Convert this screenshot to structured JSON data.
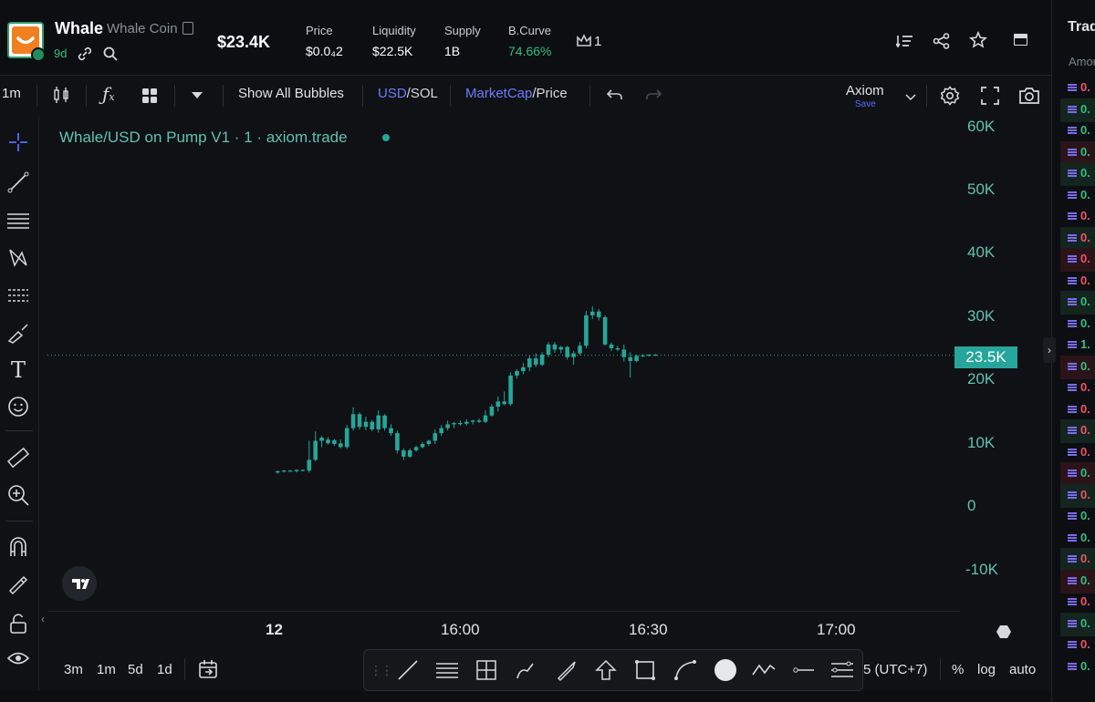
{
  "token": {
    "symbol": "Whale",
    "name": "Whale Coin",
    "age": "9d",
    "market_cap": "$23.4K"
  },
  "stats": [
    {
      "label": "Price",
      "value": "$0.0₄2"
    },
    {
      "label": "Liquidity",
      "value": "$22.5K"
    },
    {
      "label": "Supply",
      "value": "1B"
    },
    {
      "label": "B.Curve",
      "value": "74.66%"
    }
  ],
  "holders_count": "1",
  "toolbar": {
    "interval": "1m",
    "show_bubbles": "Show All Bubbles",
    "currency_primary": "USD",
    "currency_secondary": "/SOL",
    "metric_primary": "MarketCap",
    "metric_secondary": "/Price",
    "layout_name": "Axiom",
    "layout_save": "Save"
  },
  "chart_title": "Whale/USD on Pump V1 · 1 · axiom.trade",
  "price_tag": "23.5K",
  "y_axis_labels": [
    "60K",
    "50K",
    "40K",
    "30K",
    "20K",
    "10K",
    "0",
    "-10K"
  ],
  "x_axis_labels": [
    "12",
    "16:00",
    "16:30",
    "17:00"
  ],
  "bottom": {
    "ranges": [
      "3m",
      "1m",
      "5d",
      "1d"
    ],
    "timezone": "5 (UTC+7)",
    "percent": "%",
    "log": "log",
    "auto": "auto"
  },
  "sidebar": {
    "header": "Trad",
    "sub_header": "Amou",
    "rows": [
      {
        "value": "0.",
        "color": "#f05261"
      },
      {
        "value": "0.",
        "color": "#2fbf7f"
      },
      {
        "value": "0.",
        "color": "#2fbf7f"
      },
      {
        "value": "0.",
        "color": "#2fbf7f"
      },
      {
        "value": "0.",
        "color": "#2fbf7f"
      },
      {
        "value": "0.",
        "color": "#2fbf7f"
      },
      {
        "value": "0.",
        "color": "#f05261"
      },
      {
        "value": "0.",
        "color": "#f05261"
      },
      {
        "value": "0.",
        "color": "#f05261"
      },
      {
        "value": "0.",
        "color": "#f05261"
      },
      {
        "value": "0.",
        "color": "#2fbf7f"
      },
      {
        "value": "0.",
        "color": "#2fbf7f"
      },
      {
        "value": "1.",
        "color": "#2fbf7f"
      },
      {
        "value": "0.",
        "color": "#2fbf7f"
      },
      {
        "value": "0.",
        "color": "#f05261"
      },
      {
        "value": "0.",
        "color": "#f05261"
      },
      {
        "value": "0.",
        "color": "#f05261"
      },
      {
        "value": "0.",
        "color": "#f05261"
      },
      {
        "value": "0.",
        "color": "#2fbf7f"
      },
      {
        "value": "0.",
        "color": "#f05261"
      },
      {
        "value": "0.",
        "color": "#2fbf7f"
      },
      {
        "value": "0.",
        "color": "#2fbf7f"
      },
      {
        "value": "0.",
        "color": "#f05261"
      },
      {
        "value": "0.",
        "color": "#2fbf7f"
      },
      {
        "value": "0.",
        "color": "#f05261"
      },
      {
        "value": "0.",
        "color": "#2fbf7f"
      },
      {
        "value": "0.",
        "color": "#f05261"
      },
      {
        "value": "0.",
        "color": "#2fbf7f"
      }
    ]
  },
  "chart_data": {
    "type": "candlestick",
    "y_axis_range": [
      -10000,
      60000
    ],
    "current_value": 23500,
    "candles": [
      {
        "o": 5000,
        "h": 5300,
        "l": 4800,
        "c": 5200
      },
      {
        "o": 5200,
        "h": 5400,
        "l": 5000,
        "c": 5300
      },
      {
        "o": 5300,
        "h": 5400,
        "l": 5100,
        "c": 5200
      },
      {
        "o": 5200,
        "h": 5500,
        "l": 5000,
        "c": 5400
      },
      {
        "o": 5400,
        "h": 5500,
        "l": 5200,
        "c": 5300
      },
      {
        "o": 5300,
        "h": 10000,
        "l": 5000,
        "c": 7000
      },
      {
        "o": 7000,
        "h": 11500,
        "l": 6800,
        "c": 10000
      },
      {
        "o": 10000,
        "h": 10800,
        "l": 9000,
        "c": 10500
      },
      {
        "o": 10200,
        "h": 10600,
        "l": 9400,
        "c": 9600
      },
      {
        "o": 9500,
        "h": 10300,
        "l": 9200,
        "c": 10100
      },
      {
        "o": 9600,
        "h": 10200,
        "l": 8800,
        "c": 9000
      },
      {
        "o": 9000,
        "h": 12500,
        "l": 8700,
        "c": 12000
      },
      {
        "o": 12000,
        "h": 15300,
        "l": 11600,
        "c": 14200
      },
      {
        "o": 14200,
        "h": 14500,
        "l": 11800,
        "c": 12200
      },
      {
        "o": 12200,
        "h": 13800,
        "l": 11700,
        "c": 13000
      },
      {
        "o": 13000,
        "h": 13300,
        "l": 11500,
        "c": 11800
      },
      {
        "o": 11800,
        "h": 14800,
        "l": 11300,
        "c": 14000
      },
      {
        "o": 14000,
        "h": 14200,
        "l": 11600,
        "c": 12000
      },
      {
        "o": 12000,
        "h": 12600,
        "l": 10800,
        "c": 11200
      },
      {
        "o": 11200,
        "h": 11600,
        "l": 8000,
        "c": 8500
      },
      {
        "o": 8500,
        "h": 8800,
        "l": 7000,
        "c": 7500
      },
      {
        "o": 7500,
        "h": 8800,
        "l": 7300,
        "c": 8500
      },
      {
        "o": 8500,
        "h": 9200,
        "l": 8300,
        "c": 9000
      },
      {
        "o": 9000,
        "h": 9800,
        "l": 8800,
        "c": 9500
      },
      {
        "o": 9500,
        "h": 10200,
        "l": 9200,
        "c": 10000
      },
      {
        "o": 10000,
        "h": 11800,
        "l": 9500,
        "c": 11200
      },
      {
        "o": 11200,
        "h": 12500,
        "l": 10800,
        "c": 12000
      },
      {
        "o": 12000,
        "h": 13200,
        "l": 11600,
        "c": 12600
      },
      {
        "o": 12600,
        "h": 13000,
        "l": 12000,
        "c": 12800
      },
      {
        "o": 12800,
        "h": 13200,
        "l": 12400,
        "c": 12700
      },
      {
        "o": 12700,
        "h": 13400,
        "l": 12400,
        "c": 13000
      },
      {
        "o": 13000,
        "h": 13300,
        "l": 12600,
        "c": 13200
      },
      {
        "o": 13200,
        "h": 13500,
        "l": 12800,
        "c": 13000
      },
      {
        "o": 13000,
        "h": 14800,
        "l": 12800,
        "c": 14000
      },
      {
        "o": 14000,
        "h": 15800,
        "l": 13800,
        "c": 15400
      },
      {
        "o": 15400,
        "h": 17000,
        "l": 14600,
        "c": 16200
      },
      {
        "o": 16200,
        "h": 17800,
        "l": 15600,
        "c": 15800
      },
      {
        "o": 15800,
        "h": 20800,
        "l": 15500,
        "c": 20300
      },
      {
        "o": 20300,
        "h": 21300,
        "l": 19800,
        "c": 21000
      },
      {
        "o": 21000,
        "h": 22300,
        "l": 20500,
        "c": 21600
      },
      {
        "o": 21600,
        "h": 23400,
        "l": 21000,
        "c": 23000
      },
      {
        "o": 23000,
        "h": 23800,
        "l": 21600,
        "c": 22000
      },
      {
        "o": 22000,
        "h": 24000,
        "l": 21800,
        "c": 23600
      },
      {
        "o": 23600,
        "h": 25600,
        "l": 23200,
        "c": 25200
      },
      {
        "o": 25200,
        "h": 25600,
        "l": 23900,
        "c": 24400
      },
      {
        "o": 24400,
        "h": 25000,
        "l": 23800,
        "c": 24800
      },
      {
        "o": 24800,
        "h": 25000,
        "l": 22800,
        "c": 23200
      },
      {
        "o": 23200,
        "h": 24200,
        "l": 22000,
        "c": 23800
      },
      {
        "o": 23800,
        "h": 25600,
        "l": 23500,
        "c": 25000
      },
      {
        "o": 25000,
        "h": 30500,
        "l": 24600,
        "c": 29800
      },
      {
        "o": 29800,
        "h": 31200,
        "l": 29200,
        "c": 30400
      },
      {
        "o": 30400,
        "h": 30800,
        "l": 29000,
        "c": 29500
      },
      {
        "o": 29500,
        "h": 29800,
        "l": 25000,
        "c": 25200
      },
      {
        "o": 25200,
        "h": 25500,
        "l": 24200,
        "c": 24600
      },
      {
        "o": 24600,
        "h": 25000,
        "l": 24200,
        "c": 24400
      },
      {
        "o": 24400,
        "h": 25200,
        "l": 22500,
        "c": 23200
      },
      {
        "o": 23200,
        "h": 24000,
        "l": 20000,
        "c": 22600
      },
      {
        "o": 22600,
        "h": 23600,
        "l": 22400,
        "c": 23400
      },
      {
        "o": 23400,
        "h": 23700,
        "l": 23200,
        "c": 23500
      },
      {
        "o": 23500,
        "h": 23700,
        "l": 23300,
        "c": 23600
      },
      {
        "o": 23600,
        "h": 23700,
        "l": 23400,
        "c": 23500
      }
    ],
    "colors": {
      "up": "#26a69a",
      "down": "#26a69a",
      "bg": "#101114"
    }
  }
}
